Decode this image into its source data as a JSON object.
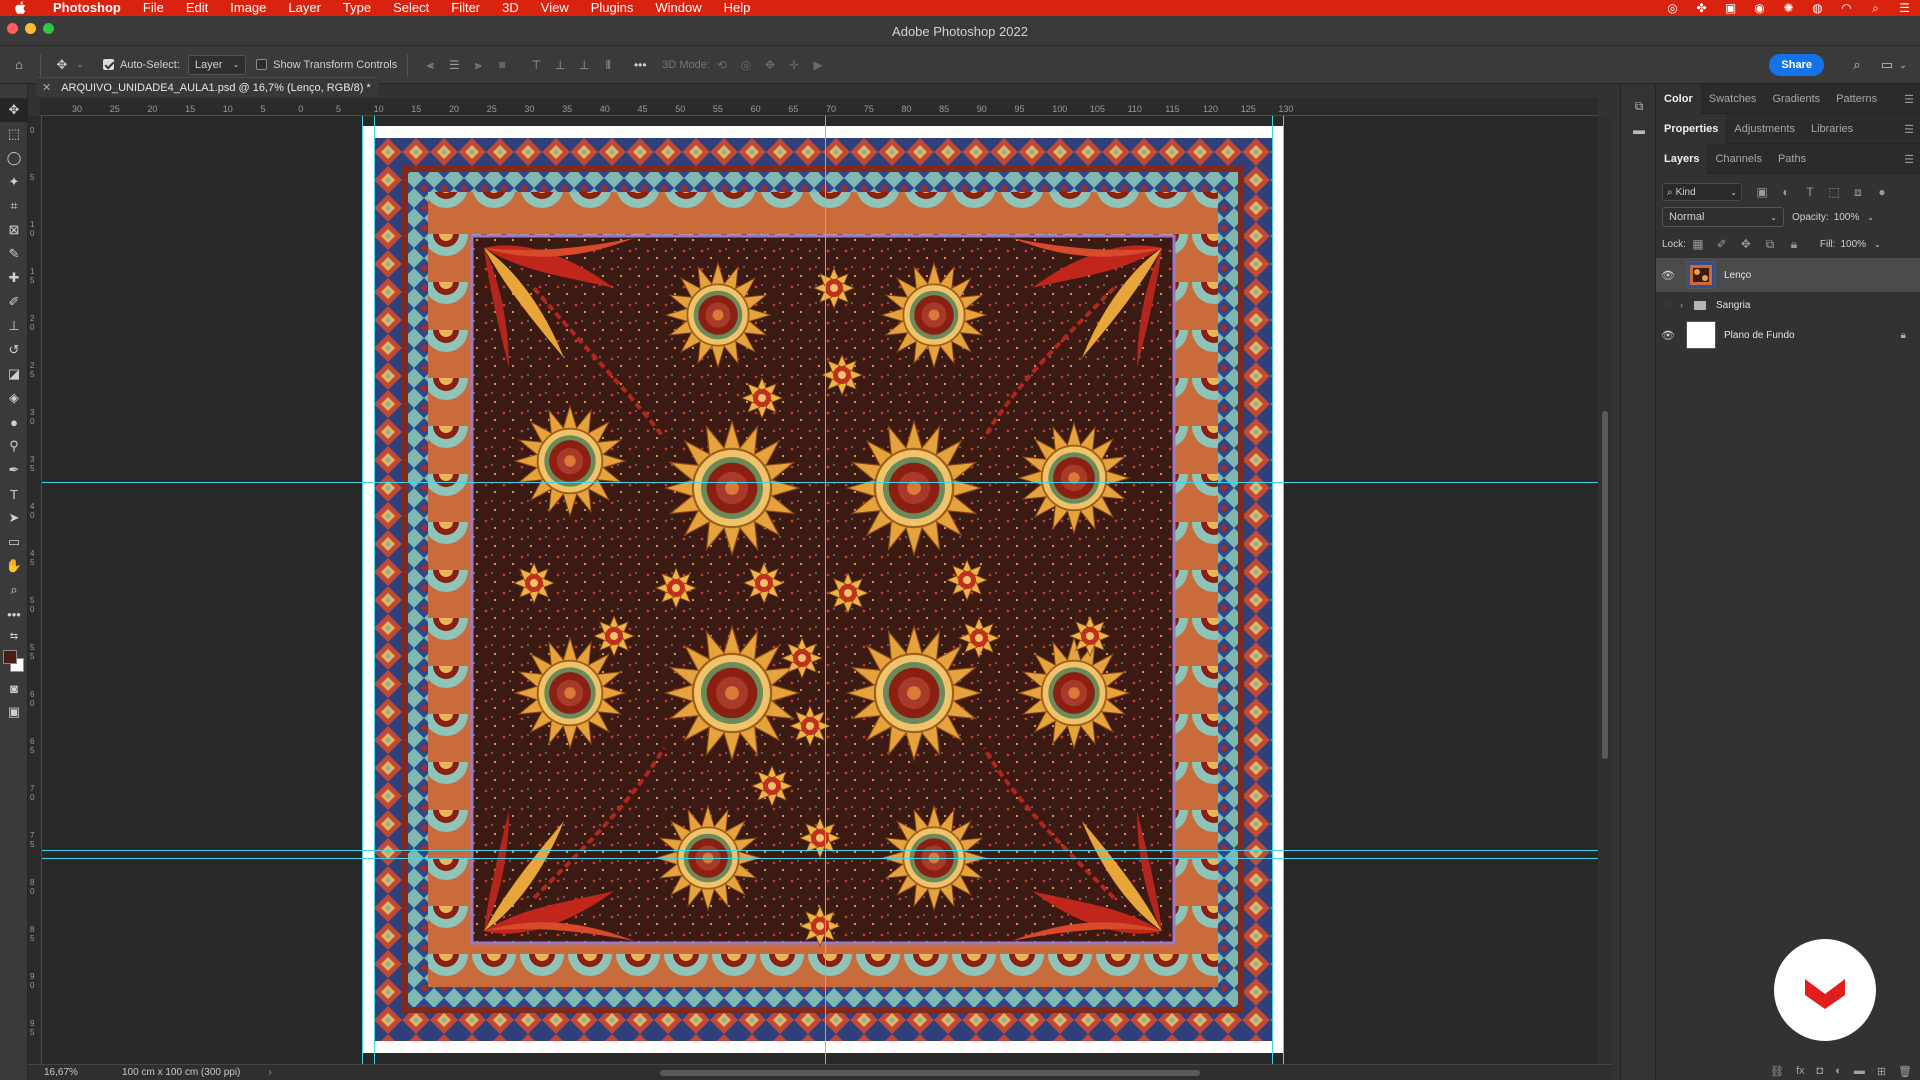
{
  "menubar": {
    "app": "Photoshop",
    "items": [
      "File",
      "Edit",
      "Image",
      "Layer",
      "Type",
      "Select",
      "Filter",
      "3D",
      "View",
      "Plugins",
      "Window",
      "Help"
    ],
    "status_icons": [
      "creative-cloud-icon",
      "extensions-icon",
      "adobe-icon",
      "sync-icon",
      "notification-icon",
      "cast-icon",
      "wifi-icon",
      "spotlight-icon",
      "control-center-icon"
    ]
  },
  "window": {
    "title": "Adobe Photoshop 2022"
  },
  "options": {
    "auto_select_label": "Auto-Select:",
    "auto_select_checked": true,
    "target": "Layer",
    "show_transform_label": "Show Transform Controls",
    "show_transform_checked": false,
    "mode_3d_label": "3D Mode:",
    "more_label": "•••",
    "share_label": "Share"
  },
  "document": {
    "tab_title": "ARQUIVO_UNIDADE4_AULA1.psd @ 16,7% (Lenço, RGB/8) *",
    "zoom": "16,67%",
    "size_info": "100 cm x 100 cm (300 ppi)"
  },
  "ruler": {
    "top_labels": [
      "30",
      "25",
      "20",
      "15",
      "10",
      "5",
      "0",
      "5",
      "10",
      "15",
      "20",
      "25",
      "30",
      "35",
      "40",
      "45",
      "50",
      "55",
      "60",
      "65",
      "70",
      "75",
      "80",
      "85",
      "90",
      "95",
      "100",
      "105",
      "110",
      "115",
      "120",
      "125",
      "130"
    ],
    "left_labels": [
      "0",
      "5",
      "1 0",
      "1 5",
      "2 0",
      "2 5",
      "3 0",
      "3 5",
      "4 0",
      "4 5",
      "5 0",
      "5 5",
      "6 0",
      "6 5",
      "7 0",
      "7 5",
      "8 0",
      "8 5",
      "9 0",
      "9 5"
    ]
  },
  "panels": {
    "group1": {
      "tabs": [
        "Color",
        "Swatches",
        "Gradients",
        "Patterns"
      ],
      "active": "Color"
    },
    "group2": {
      "tabs": [
        "Properties",
        "Adjustments",
        "Libraries"
      ],
      "active": "Properties"
    },
    "group3": {
      "tabs": [
        "Layers",
        "Channels",
        "Paths"
      ],
      "active": "Layers"
    },
    "filter_kind": "Kind",
    "blend_mode": "Normal",
    "opacity_label": "Opacity:",
    "opacity_value": "100%",
    "lock_label": "Lock:",
    "fill_label": "Fill:",
    "fill_value": "100%",
    "layers": [
      {
        "name": "Lenço",
        "visible": true,
        "selected": true,
        "type": "image"
      },
      {
        "name": "Sangria",
        "visible": false,
        "selected": false,
        "type": "group"
      },
      {
        "name": "Plano de Fundo",
        "visible": true,
        "selected": false,
        "type": "background",
        "locked": true
      }
    ]
  },
  "colors": {
    "menubar": "#d9230f",
    "accent": "#1473e6",
    "guide": "#47d3e6",
    "scarf_ground": "#3a1a12",
    "scarf_red": "#b3261e",
    "scarf_gold": "#e6a23c",
    "scarf_blue": "#2c4a8a",
    "scarf_teal": "#7fb8b0",
    "watermark": "#e01e1e"
  }
}
